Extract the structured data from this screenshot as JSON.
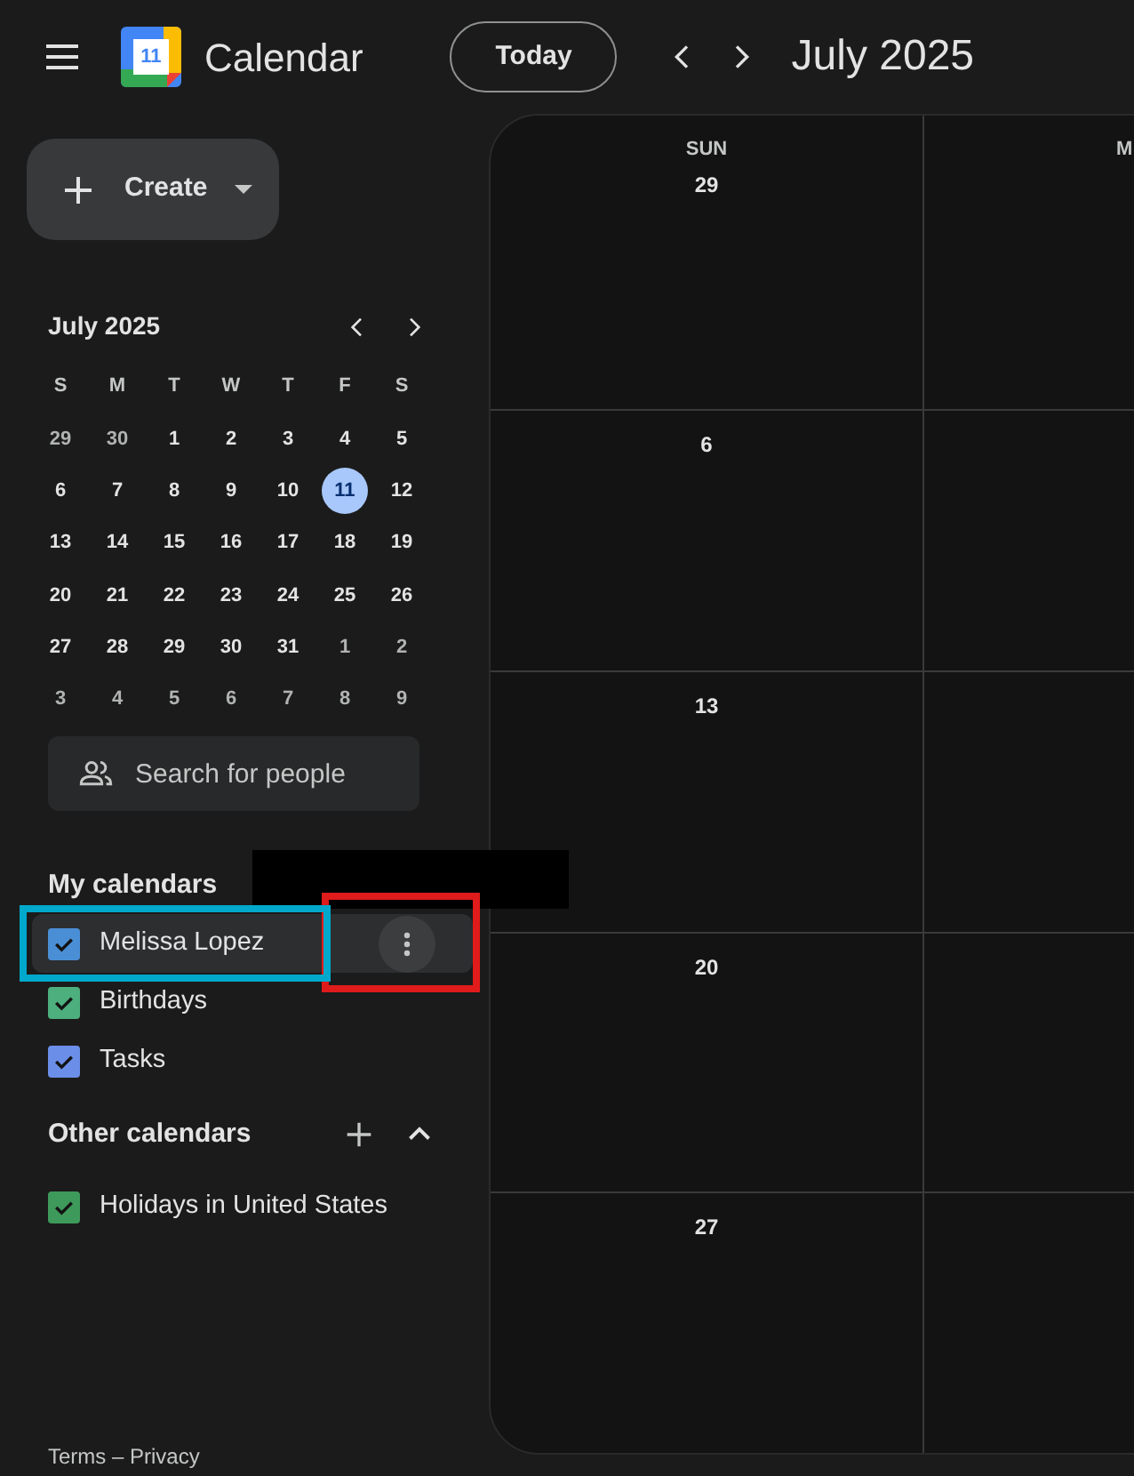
{
  "header": {
    "app_name": "Calendar",
    "logo_day": "11",
    "today_button": "Today",
    "period": "July 2025"
  },
  "sidebar": {
    "create_button": "Create",
    "mini_calendar": {
      "title": "July 2025",
      "weekdays": [
        "S",
        "M",
        "T",
        "W",
        "T",
        "F",
        "S"
      ],
      "weeks": [
        [
          {
            "d": "29",
            "outside": true,
            "selected": false
          },
          {
            "d": "30",
            "outside": true,
            "selected": false
          },
          {
            "d": "1",
            "outside": false,
            "selected": false
          },
          {
            "d": "2",
            "outside": false,
            "selected": false
          },
          {
            "d": "3",
            "outside": false,
            "selected": false
          },
          {
            "d": "4",
            "outside": false,
            "selected": false
          },
          {
            "d": "5",
            "outside": false,
            "selected": false
          }
        ],
        [
          {
            "d": "6",
            "outside": false,
            "selected": false
          },
          {
            "d": "7",
            "outside": false,
            "selected": false
          },
          {
            "d": "8",
            "outside": false,
            "selected": false
          },
          {
            "d": "9",
            "outside": false,
            "selected": false
          },
          {
            "d": "10",
            "outside": false,
            "selected": false
          },
          {
            "d": "11",
            "outside": false,
            "selected": true
          },
          {
            "d": "12",
            "outside": false,
            "selected": false
          }
        ],
        [
          {
            "d": "13",
            "outside": false,
            "selected": false
          },
          {
            "d": "14",
            "outside": false,
            "selected": false
          },
          {
            "d": "15",
            "outside": false,
            "selected": false
          },
          {
            "d": "16",
            "outside": false,
            "selected": false
          },
          {
            "d": "17",
            "outside": false,
            "selected": false
          },
          {
            "d": "18",
            "outside": false,
            "selected": false
          },
          {
            "d": "19",
            "outside": false,
            "selected": false
          }
        ],
        [
          {
            "d": "20",
            "outside": false,
            "selected": false
          },
          {
            "d": "21",
            "outside": false,
            "selected": false
          },
          {
            "d": "22",
            "outside": false,
            "selected": false
          },
          {
            "d": "23",
            "outside": false,
            "selected": false
          },
          {
            "d": "24",
            "outside": false,
            "selected": false
          },
          {
            "d": "25",
            "outside": false,
            "selected": false
          },
          {
            "d": "26",
            "outside": false,
            "selected": false
          }
        ],
        [
          {
            "d": "27",
            "outside": false,
            "selected": false
          },
          {
            "d": "28",
            "outside": false,
            "selected": false
          },
          {
            "d": "29",
            "outside": false,
            "selected": false
          },
          {
            "d": "30",
            "outside": false,
            "selected": false
          },
          {
            "d": "31",
            "outside": false,
            "selected": false
          },
          {
            "d": "1",
            "outside": true,
            "selected": false
          },
          {
            "d": "2",
            "outside": true,
            "selected": false
          }
        ],
        [
          {
            "d": "3",
            "outside": true,
            "selected": false
          },
          {
            "d": "4",
            "outside": true,
            "selected": false
          },
          {
            "d": "5",
            "outside": true,
            "selected": false
          },
          {
            "d": "6",
            "outside": true,
            "selected": false
          },
          {
            "d": "7",
            "outside": true,
            "selected": false
          },
          {
            "d": "8",
            "outside": true,
            "selected": false
          },
          {
            "d": "9",
            "outside": true,
            "selected": false
          }
        ]
      ]
    },
    "search": {
      "placeholder": "Search for people"
    },
    "my_calendars": {
      "title": "My calendars",
      "items": [
        {
          "label": "Melissa Lopez",
          "checked": true,
          "color": "#4a8fd6",
          "hovered": true
        },
        {
          "label": "Birthdays",
          "checked": true,
          "color": "#4caf7d",
          "hovered": false
        },
        {
          "label": "Tasks",
          "checked": true,
          "color": "#6b8ee8",
          "hovered": false
        }
      ]
    },
    "other_calendars": {
      "title": "Other calendars",
      "items": [
        {
          "label": "Holidays in United States",
          "checked": true,
          "color": "#3e9a5b",
          "hovered": false
        }
      ]
    },
    "footer": "Terms – Privacy"
  },
  "grid": {
    "weekdays": [
      "SUN",
      "M"
    ],
    "weeks": [
      {
        "dates": [
          "29"
        ]
      },
      {
        "dates": [
          "6"
        ]
      },
      {
        "dates": [
          "13"
        ]
      },
      {
        "dates": [
          "20"
        ]
      },
      {
        "dates": [
          "27"
        ]
      }
    ]
  },
  "annotations": [
    {
      "kind": "redaction"
    },
    {
      "kind": "outline",
      "color": "#e01b1b"
    },
    {
      "kind": "outline",
      "color": "#00a8cc"
    }
  ]
}
